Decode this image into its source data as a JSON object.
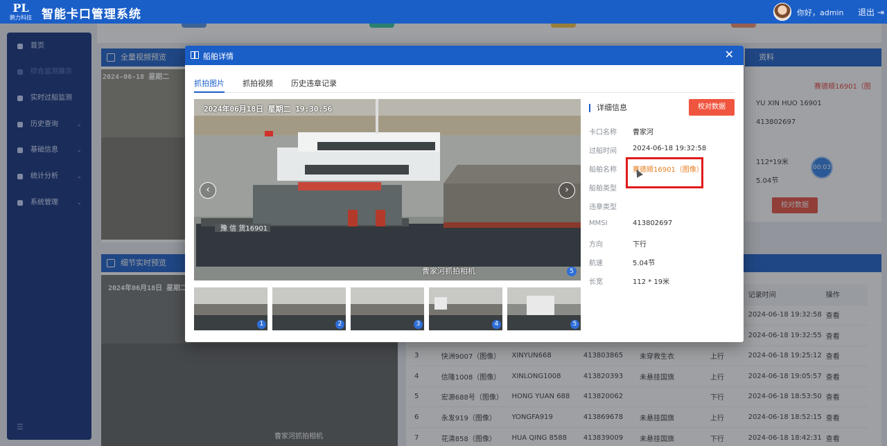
{
  "app": {
    "logo_text": "鹏力科技",
    "title": "智能卡口管理系统",
    "greeting": "你好，admin",
    "logout": "退出"
  },
  "sidebar": {
    "items": [
      {
        "label": "首页",
        "icon": "home-icon"
      },
      {
        "label": "综合监测展示",
        "icon": "monitor-icon",
        "active": true
      },
      {
        "label": "实时过船监测",
        "icon": "ship-icon"
      },
      {
        "label": "历史查询",
        "icon": "history-icon",
        "caret": true
      },
      {
        "label": "基础信息",
        "icon": "grid-icon",
        "caret": true
      },
      {
        "label": "统计分析",
        "icon": "chart-icon",
        "caret": true
      },
      {
        "label": "系统管理",
        "icon": "settings-icon",
        "caret": true
      }
    ]
  },
  "background": {
    "panel1_title": "全量视频预览",
    "panel1_timestamp": "2024-06-18 星期二",
    "panel2_title": "细节实时预览",
    "panel2_timestamp": "2024年06月18日 星期二",
    "panel2_caption": "曹家河抓拍相机",
    "right_panel_title": "资料",
    "right_panel": {
      "ship_name": "赛德顺16901（图",
      "pinyin": "YU XIN HUO 16901",
      "mmsi": "413802697",
      "size": "112*19米",
      "speed": "5.04节",
      "calibrate": "校对数据"
    },
    "timer": "00:03"
  },
  "records": {
    "headers": [
      "",
      "",
      "",
      "",
      "",
      "",
      "记录时间",
      "操作"
    ],
    "rows": [
      {
        "no": "",
        "ship": "",
        "pinyin": "",
        "mmsi": "",
        "violation": "",
        "direction": "",
        "time": "2024-06-18 19:32:58",
        "action": "查看"
      },
      {
        "no": "",
        "ship": "",
        "pinyin": "",
        "mmsi": "",
        "violation": "",
        "direction": "",
        "time": "2024-06-18 19:32:55",
        "action": "查看"
      },
      {
        "no": "3",
        "ship": "快洲9007（图像）",
        "pinyin": "XINYUN668",
        "mmsi": "413803865",
        "violation": "未穿救生衣",
        "direction": "上行",
        "time": "2024-06-18 19:25:12",
        "action": "查看"
      },
      {
        "no": "4",
        "ship": "信隆1008（图像）",
        "pinyin": "XINLONG1008",
        "mmsi": "413820393",
        "violation": "未悬挂国旗",
        "direction": "上行",
        "time": "2024-06-18 19:05:57",
        "action": "查看"
      },
      {
        "no": "5",
        "ship": "宏源688号（图像）",
        "pinyin": "HONG YUAN 688",
        "mmsi": "413820062",
        "violation": "",
        "direction": "下行",
        "time": "2024-06-18 18:53:50",
        "action": "查看"
      },
      {
        "no": "6",
        "ship": "永发919（图像）",
        "pinyin": "YONGFA919",
        "mmsi": "413869678",
        "violation": "未悬挂国旗",
        "direction": "上行",
        "time": "2024-06-18 18:52:15",
        "action": "查看"
      },
      {
        "no": "7",
        "ship": "花清858（图像）",
        "pinyin": "HUA QING 8588",
        "mmsi": "413839009",
        "violation": "未悬挂国旗",
        "direction": "下行",
        "time": "2024-06-18 18:42:31",
        "action": "查看"
      }
    ]
  },
  "modal": {
    "title": "船舶详情",
    "close": "✕",
    "tabs": [
      "抓拍图片",
      "抓拍视频",
      "历史违章记录"
    ],
    "photo": {
      "timestamp": "2024年06月18日  星期二  19:30:56",
      "caption": "曹家河抓拍相机",
      "hull_text": "豫 信 货16901",
      "index": "5"
    },
    "thumbs": [
      "1",
      "2",
      "3",
      "4",
      "5"
    ],
    "detail_title": "详细信息",
    "calibrate": "校对数据",
    "fields": [
      {
        "label": "卡口名称",
        "value": "曹家河"
      },
      {
        "label": "过船时间",
        "value": "2024-06-18 19:32:58"
      },
      {
        "label": "船舶名称",
        "value": "赛德顺16901（图像）"
      },
      {
        "label": "船舶类型",
        "value": ""
      },
      {
        "label": "违章类型",
        "value": ""
      },
      {
        "label": "MMSI",
        "value": "413802697"
      },
      {
        "label": "方向",
        "value": "下行"
      },
      {
        "label": "航速",
        "value": "5.04节"
      },
      {
        "label": "长宽",
        "value": "112 * 19米"
      }
    ]
  },
  "colors": {
    "primary": "#1a5ec8",
    "sidebar": "#0f2f7a",
    "danger": "#f0553f",
    "ship_link": "#e67e22",
    "highlight_box": "#e01b1b"
  }
}
